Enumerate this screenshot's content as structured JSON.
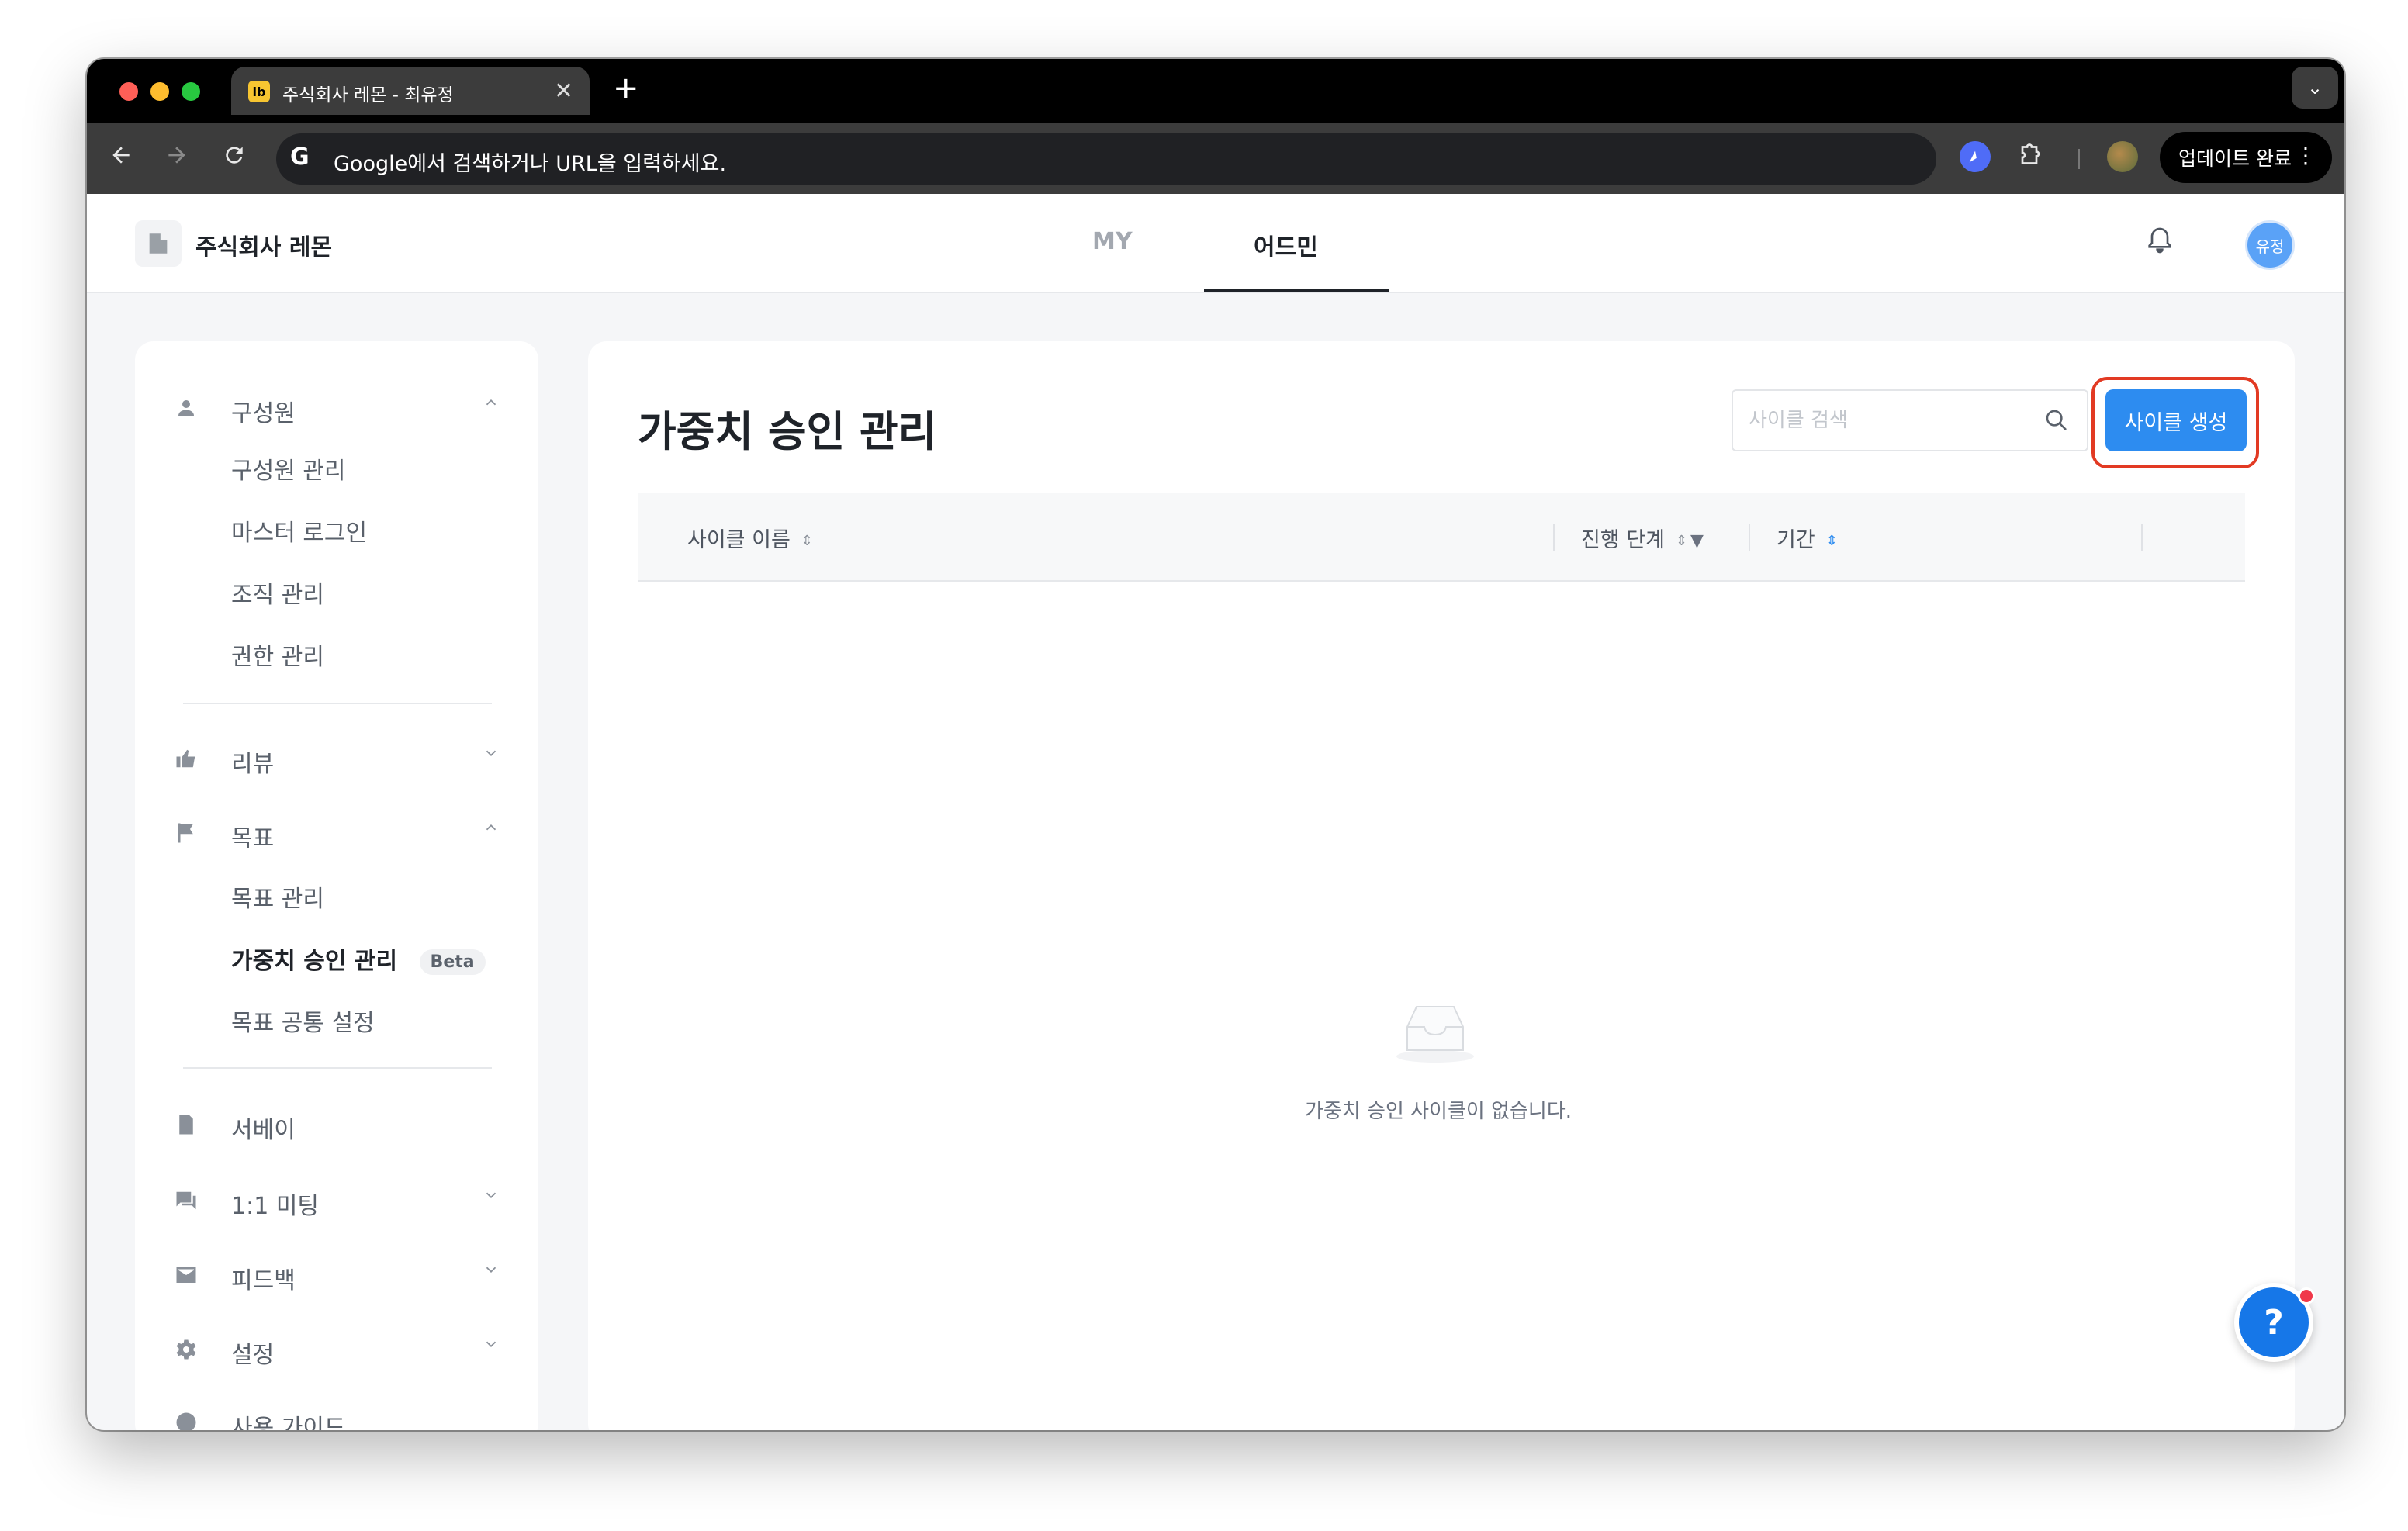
{
  "browser": {
    "tab_favicon": "lb",
    "tab_title": "주식회사 레몬 - 최유정",
    "tab_close": "✕",
    "new_tab": "+",
    "tab_menu": "⌄",
    "omnibox_logo": "G",
    "omnibox_placeholder": "Google에서 검색하거나 URL을 입력하세요.",
    "update_label": "업데이트 완료",
    "extension_icons": [
      "perplexity-icon",
      "puzzle-icon"
    ]
  },
  "header": {
    "company_name": "주식회사 레몬",
    "tabs": [
      {
        "label": "MY",
        "active": false
      },
      {
        "label": "어드민",
        "active": true
      }
    ],
    "avatar_text": "유정"
  },
  "sidebar": {
    "groups": [
      {
        "label": "구성원",
        "icon": "person-icon",
        "expanded": true,
        "items": [
          "구성원 관리",
          "마스터 로그인",
          "조직 관리",
          "권한 관리"
        ]
      },
      {
        "label": "리뷰",
        "icon": "thumbs-up-icon",
        "expanded": false,
        "items": []
      },
      {
        "label": "목표",
        "icon": "flag-icon",
        "expanded": true,
        "items": [
          "목표 관리",
          "가중치 승인 관리",
          "목표 공통 설정"
        ]
      },
      {
        "label": "서베이",
        "icon": "document-icon",
        "expanded": false,
        "items": []
      },
      {
        "label": "1:1 미팅",
        "icon": "chat-icon",
        "expanded": false,
        "items": []
      },
      {
        "label": "피드백",
        "icon": "mail-icon",
        "expanded": false,
        "items": []
      },
      {
        "label": "설정",
        "icon": "gear-icon",
        "expanded": false,
        "items": []
      },
      {
        "label": "사용 가이드",
        "icon": "help-circle-icon",
        "expanded": false,
        "items": []
      }
    ],
    "active_item": "가중치 승인 관리",
    "beta_badge": "Beta"
  },
  "main": {
    "title": "가중치 승인 관리",
    "search_placeholder": "사이클 검색",
    "create_button": "사이클 생성",
    "columns": [
      "사이클 이름",
      "진행 단계",
      "기간"
    ],
    "empty_message": "가중치 승인 사이클이 없습니다."
  },
  "help": {
    "label": "?"
  },
  "colors": {
    "primary": "#2d8cf0",
    "highlight": "#e23a23",
    "text_primary": "#1f2329",
    "text_secondary": "#5a616b"
  }
}
